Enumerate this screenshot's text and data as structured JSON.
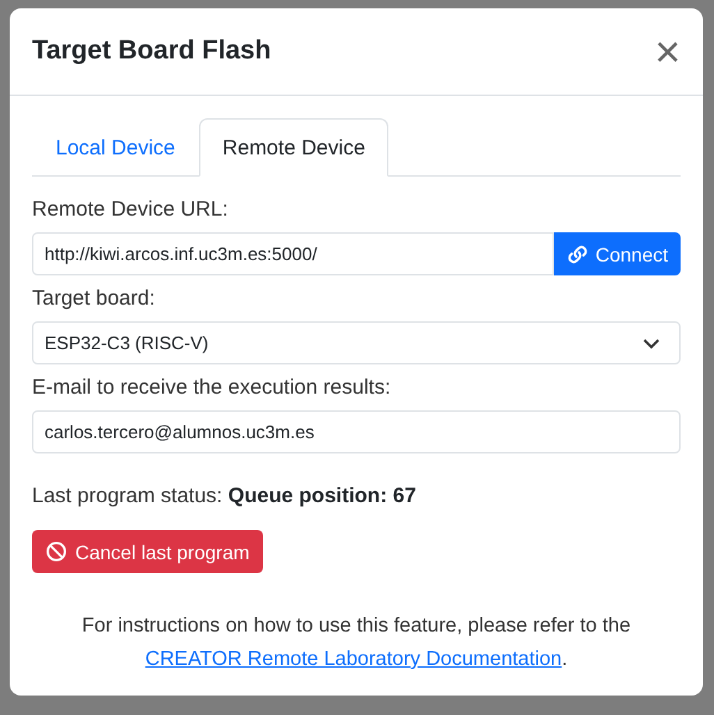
{
  "dialog": {
    "title": "Target Board Flash",
    "close": "×"
  },
  "tabs": [
    {
      "label": "Local Device",
      "selected": false
    },
    {
      "label": "Remote Device",
      "selected": true
    }
  ],
  "url_field": {
    "label": "Remote Device URL:",
    "value": "http://kiwi.arcos.inf.uc3m.es:5000/",
    "button": "Connect"
  },
  "board_field": {
    "label": "Target board:",
    "value": "ESP32-C3 (RISC-V)"
  },
  "email_field": {
    "label": "E-mail to receive the execution results:",
    "value": "carlos.tercero@alumnos.uc3m.es"
  },
  "status": {
    "label": "Last program status:",
    "value": "Queue position: 67"
  },
  "cancel_button": "Cancel last program",
  "help": {
    "text": "For instructions on how to use this feature, please refer to the",
    "link": "CREATOR Remote Laboratory Documentation",
    "end": "."
  }
}
